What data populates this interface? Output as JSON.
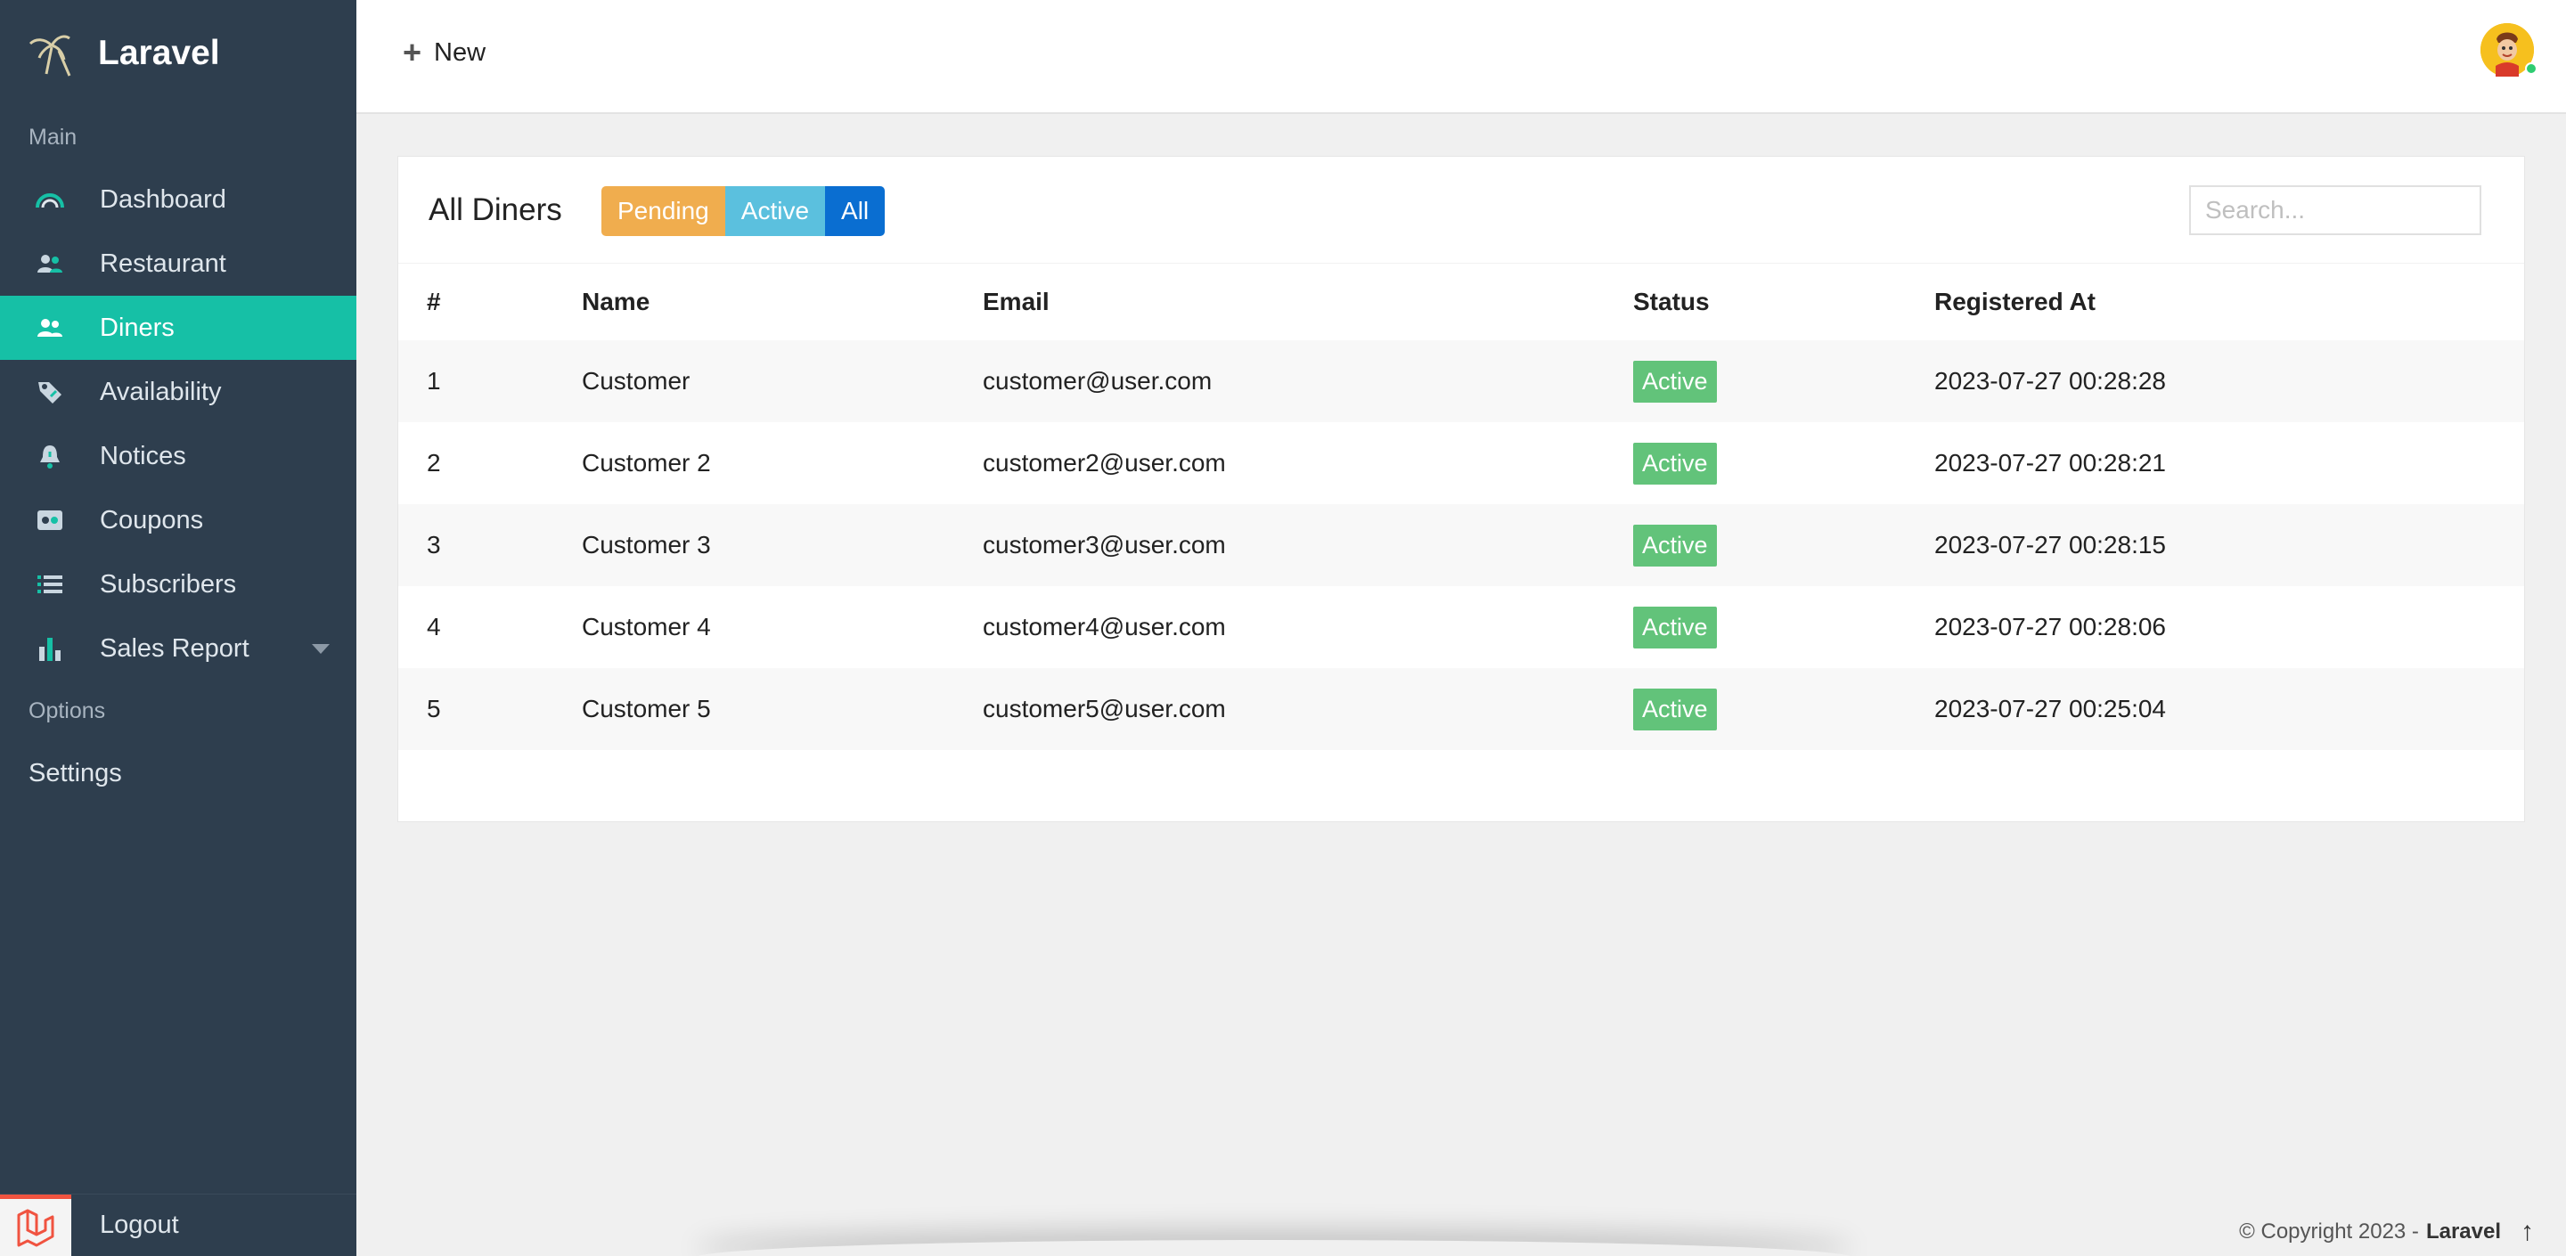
{
  "brand": {
    "name": "Laravel"
  },
  "sidebar": {
    "main_label": "Main",
    "options_label": "Options",
    "items": [
      {
        "label": "Dashboard",
        "icon": "gauge-icon"
      },
      {
        "label": "Restaurant",
        "icon": "users-icon"
      },
      {
        "label": "Diners",
        "icon": "users-icon",
        "active": true
      },
      {
        "label": "Availability",
        "icon": "tag-icon"
      },
      {
        "label": "Notices",
        "icon": "bell-icon"
      },
      {
        "label": "Coupons",
        "icon": "ticket-icon"
      },
      {
        "label": "Subscribers",
        "icon": "list-icon"
      },
      {
        "label": "Sales Report",
        "icon": "bar-chart-icon"
      }
    ],
    "settings_label": "Settings",
    "logout_label": "Logout"
  },
  "topbar": {
    "new_label": "New"
  },
  "card": {
    "title": "All Diners",
    "filters": {
      "pending": "Pending",
      "active": "Active",
      "all": "All"
    },
    "search_placeholder": "Search..."
  },
  "table": {
    "headers": [
      "#",
      "Name",
      "Email",
      "Status",
      "Registered At"
    ],
    "rows": [
      {
        "id": "1",
        "name": "Customer",
        "email": "customer@user.com",
        "status": "Active",
        "registered": "2023-07-27 00:28:28"
      },
      {
        "id": "2",
        "name": "Customer 2",
        "email": "customer2@user.com",
        "status": "Active",
        "registered": "2023-07-27 00:28:21"
      },
      {
        "id": "3",
        "name": "Customer 3",
        "email": "customer3@user.com",
        "status": "Active",
        "registered": "2023-07-27 00:28:15"
      },
      {
        "id": "4",
        "name": "Customer 4",
        "email": "customer4@user.com",
        "status": "Active",
        "registered": "2023-07-27 00:28:06"
      },
      {
        "id": "5",
        "name": "Customer 5",
        "email": "customer5@user.com",
        "status": "Active",
        "registered": "2023-07-27 00:25:04"
      }
    ]
  },
  "footer": {
    "copyright": "© Copyright 2023 -",
    "brand": "Laravel",
    "arrow": "↑"
  },
  "colors": {
    "sidebar_bg": "#2e3e4e",
    "active_item": "#16c0a6",
    "pending": "#f0ad4e",
    "active_filter": "#5bc0de",
    "all_filter": "#0a6ed1",
    "status_badge": "#62c37a"
  }
}
